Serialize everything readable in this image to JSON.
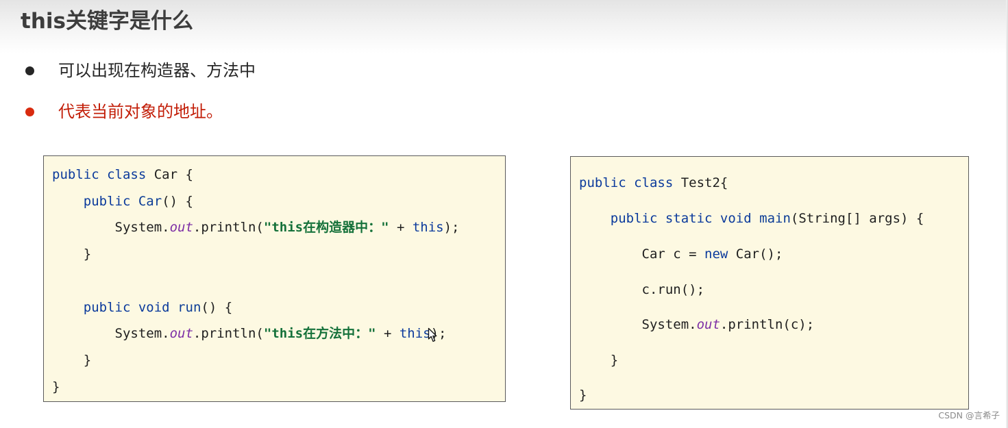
{
  "slide": {
    "title": "this关键字是什么",
    "bullets": [
      {
        "text": "可以出现在构造器、方法中",
        "color": "#262626"
      },
      {
        "text": "代表当前对象的地址。",
        "color": "#c21d07"
      }
    ]
  },
  "code_panels": {
    "car_class": {
      "background": "#fdf9e2",
      "lines": [
        [
          {
            "t": "public class",
            "s": "kw"
          },
          {
            "t": " Car {"
          }
        ],
        [
          {
            "t": "    "
          },
          {
            "t": "public",
            "s": "kw"
          },
          {
            "t": " "
          },
          {
            "t": "Car",
            "s": "mth"
          },
          {
            "t": "() {"
          }
        ],
        [
          {
            "t": "        System."
          },
          {
            "t": "out",
            "s": "fld"
          },
          {
            "t": ".println("
          },
          {
            "t": "\"this在构造器中：\"",
            "s": "str"
          },
          {
            "t": " + "
          },
          {
            "t": "this",
            "s": "kw"
          },
          {
            "t": ");"
          }
        ],
        [
          {
            "t": "    }"
          }
        ],
        [
          {
            "t": ""
          }
        ],
        [
          {
            "t": "    "
          },
          {
            "t": "public void",
            "s": "kw"
          },
          {
            "t": " "
          },
          {
            "t": "run",
            "s": "mth"
          },
          {
            "t": "() {"
          }
        ],
        [
          {
            "t": "        System."
          },
          {
            "t": "out",
            "s": "fld"
          },
          {
            "t": ".println("
          },
          {
            "t": "\"this在方法中：\"",
            "s": "str"
          },
          {
            "t": " + "
          },
          {
            "t": "this",
            "s": "kw"
          },
          {
            "t": ");"
          }
        ],
        [
          {
            "t": "    }"
          }
        ],
        [
          {
            "t": "}"
          }
        ]
      ]
    },
    "test2_class": {
      "background": "#fdf9e2",
      "lines": [
        [
          {
            "t": "public class",
            "s": "kw"
          },
          {
            "t": " Test2{"
          }
        ],
        [
          {
            "t": "    "
          },
          {
            "t": "public static void",
            "s": "kw"
          },
          {
            "t": " "
          },
          {
            "t": "main",
            "s": "mth"
          },
          {
            "t": "(String[] args) {"
          }
        ],
        [
          {
            "t": "        Car c = "
          },
          {
            "t": "new",
            "s": "kw"
          },
          {
            "t": " Car();"
          }
        ],
        [
          {
            "t": "        c.run();"
          }
        ],
        [
          {
            "t": "        System."
          },
          {
            "t": "out",
            "s": "fld"
          },
          {
            "t": ".println(c);"
          }
        ],
        [
          {
            "t": "    }"
          }
        ],
        [
          {
            "t": "}"
          }
        ]
      ]
    }
  },
  "colors": {
    "keyword": "#0b3a9c",
    "static_field": "#7d2ea5",
    "string_literal": "#15713a",
    "bullet_highlight": "#d92b0f"
  },
  "icons": {
    "cursor": "mouse-pointer-icon"
  },
  "watermark": "CSDN @言希子"
}
